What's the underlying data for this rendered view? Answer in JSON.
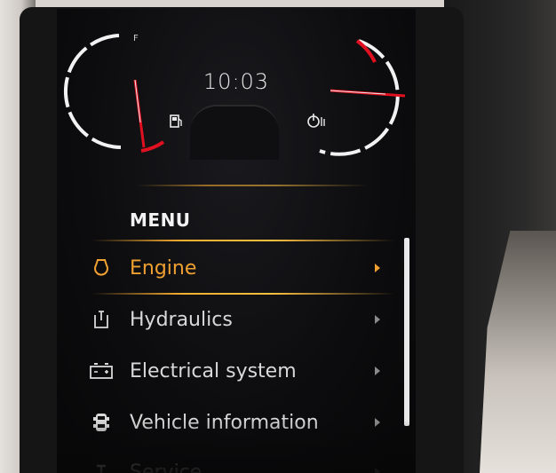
{
  "clock": {
    "time": "10:03"
  },
  "fuel_gauge": {
    "label": "F",
    "icon": "fuel-pump-icon"
  },
  "temp_gauge": {
    "icon": "engine-coolant-temp-icon"
  },
  "menu": {
    "title": "MENU",
    "items": [
      {
        "label": "Engine",
        "icon": "engine-icon",
        "selected": true
      },
      {
        "label": "Hydraulics",
        "icon": "hydraulics-icon",
        "selected": false
      },
      {
        "label": "Electrical system",
        "icon": "battery-icon",
        "selected": false
      },
      {
        "label": "Vehicle information",
        "icon": "vehicle-icon",
        "selected": false
      },
      {
        "label": "Service",
        "icon": "service-icon",
        "selected": false
      }
    ]
  },
  "colors": {
    "accent": "#f0a030",
    "needle": "#e01020",
    "text": "#d8d8d8",
    "background": "#0c0c0e"
  }
}
